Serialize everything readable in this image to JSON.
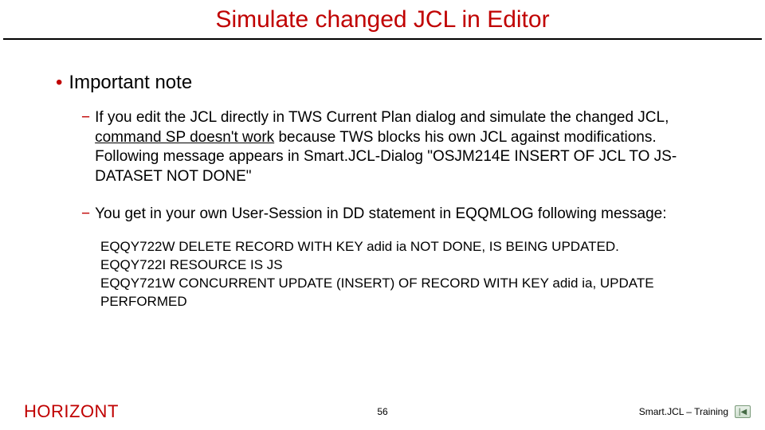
{
  "title": "Simulate changed JCL in Editor",
  "bullets": {
    "l1": "Important note",
    "l2a_pre": "If you edit the JCL directly in TWS Current Plan dialog and simulate the changed JCL, ",
    "l2a_underlined": "command SP doesn't work",
    "l2a_post": " because TWS blocks his own JCL against modifications. Following message appears in Smart.JCL-Dialog \"",
    "l2a_msg": "OSJM214E INSERT OF JCL TO JS-DATASET NOT DONE",
    "l2a_close": "\"",
    "l2b": "You get in your own User-Session in DD statement in EQQMLOG following message:"
  },
  "log": {
    "line1": "EQQY722W DELETE RECORD WITH KEY adid ia NOT DONE, IS BEING UPDATED.",
    "line2": "EQQY722I RESOURCE IS JS",
    "line3": "EQQY721W CONCURRENT UPDATE (INSERT) OF RECORD WITH KEY adid ia, UPDATE PERFORMED"
  },
  "footer": {
    "brand": "HORIZONT",
    "page": "56",
    "product": "Smart.JCL – Training",
    "nav_glyph": "|◀"
  }
}
